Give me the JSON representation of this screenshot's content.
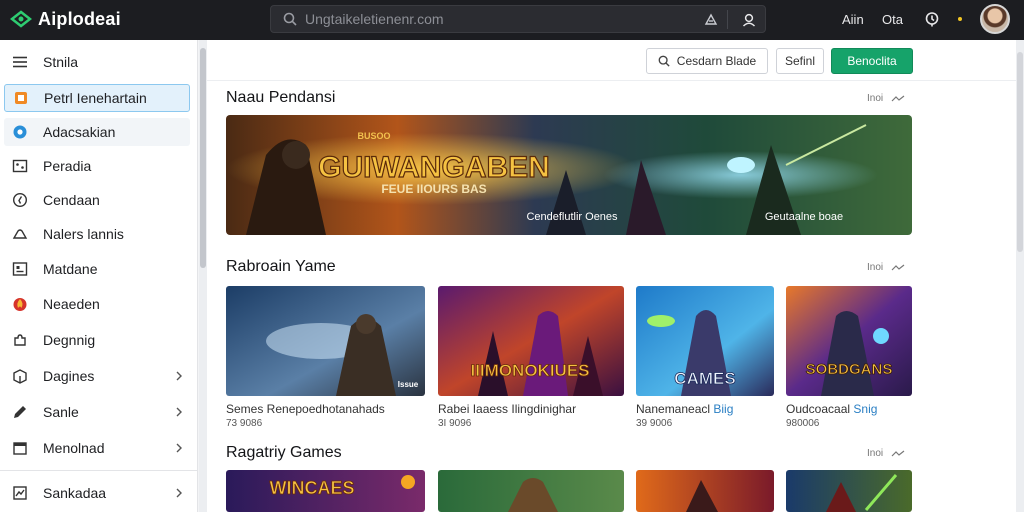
{
  "app": {
    "title": "Aiplodeai"
  },
  "search": {
    "placeholder": "Ungtaikeletienenr.com"
  },
  "topnav": {
    "link_1": "Aiin",
    "link_2": "Ota"
  },
  "sidebar": {
    "items": [
      {
        "label": "Stnila",
        "icon": "menu-icon"
      },
      {
        "label": "Petrl Ienehartain",
        "icon": "tag-icon"
      },
      {
        "label": "Adacsakian",
        "icon": "globe-icon"
      },
      {
        "label": "Peradia",
        "icon": "gallery-icon"
      },
      {
        "label": "Cendaan",
        "icon": "compass-icon"
      },
      {
        "label": "Nalers lannis",
        "icon": "cloud-icon"
      },
      {
        "label": "Matdane",
        "icon": "image-icon"
      },
      {
        "label": "Neaeden",
        "icon": "flame-icon"
      },
      {
        "label": "Degnnig",
        "icon": "puzzle-icon"
      },
      {
        "label": "Dagines",
        "icon": "box-icon"
      },
      {
        "label": "Sanle",
        "icon": "pencil-icon"
      },
      {
        "label": "Menolnad",
        "icon": "calendar-icon"
      },
      {
        "label": "Sankadaa",
        "icon": "chart-icon"
      }
    ]
  },
  "toolbar": {
    "search_button": "Cesdarn Blade",
    "secondary_button": "Sefinl",
    "primary_button": "Benoclita"
  },
  "sections": {
    "featured": {
      "title": "Naau Pendansi",
      "more": "Inoi",
      "hero_title": "GUIWANGABEN",
      "hero_subtitle": "FEUE IIOURS BAS",
      "hero_tag": "BUSOO",
      "caption_left": "Cendeflutlir Oenes",
      "caption_right": "Geutaalne boae"
    },
    "popular": {
      "title": "Rabroain Yame",
      "more": "Inoi",
      "cards": [
        {
          "title": "Semes Renepoedhotanahads",
          "highlight": "",
          "meta": "73 9086",
          "badge": "Issue"
        },
        {
          "title": "Rabei Iaaess Ilingdinighar",
          "highlight": "",
          "meta": "3I 9096",
          "badge": "IIIMONOKIUES"
        },
        {
          "title": "Nanemaneacl ",
          "highlight": "Biig",
          "meta": "39 9006",
          "badge": "CAMES"
        },
        {
          "title": "Oudcoacaal ",
          "highlight": "Snig",
          "meta": "980006",
          "badge": "SOBDGANS"
        }
      ]
    },
    "category": {
      "title": "Ragatriy Games",
      "more": "Inoi",
      "first_badge": "WINCAES"
    }
  },
  "colors": {
    "accent": "#16a36a",
    "topbar": "#1c1d21",
    "active_bg": "#e3f1fb",
    "link": "#2a7fc4"
  }
}
